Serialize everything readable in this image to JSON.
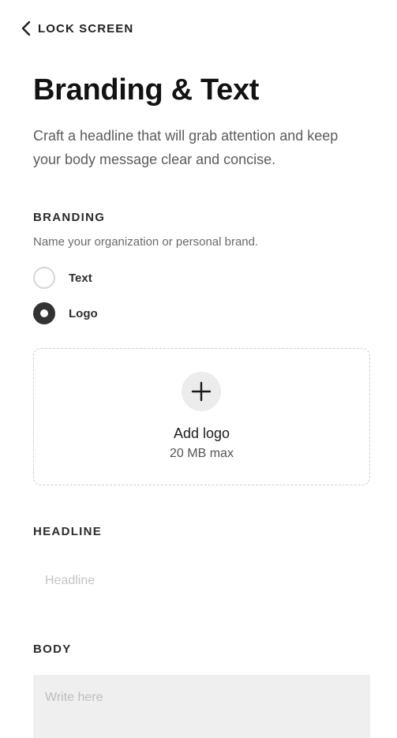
{
  "nav": {
    "back_label": "LOCK SCREEN"
  },
  "page": {
    "title": "Branding & Text",
    "description": "Craft a headline that will grab attention and keep your body message clear and concise."
  },
  "branding": {
    "label": "BRANDING",
    "helper": "Name your organization or personal brand.",
    "options": [
      {
        "label": "Text",
        "selected": false
      },
      {
        "label": "Logo",
        "selected": true
      }
    ],
    "upload": {
      "title": "Add logo",
      "limit": "20 MB max",
      "icon": "plus-icon"
    }
  },
  "headline": {
    "label": "HEADLINE",
    "placeholder": "Headline",
    "value": ""
  },
  "body": {
    "label": "BODY",
    "placeholder": "Write here",
    "value": ""
  },
  "colors": {
    "radio_selected": "#333333",
    "radio_unselected_border": "#d6d6d6",
    "upload_icon_bg": "#ececec",
    "textarea_bg": "#efefef"
  }
}
